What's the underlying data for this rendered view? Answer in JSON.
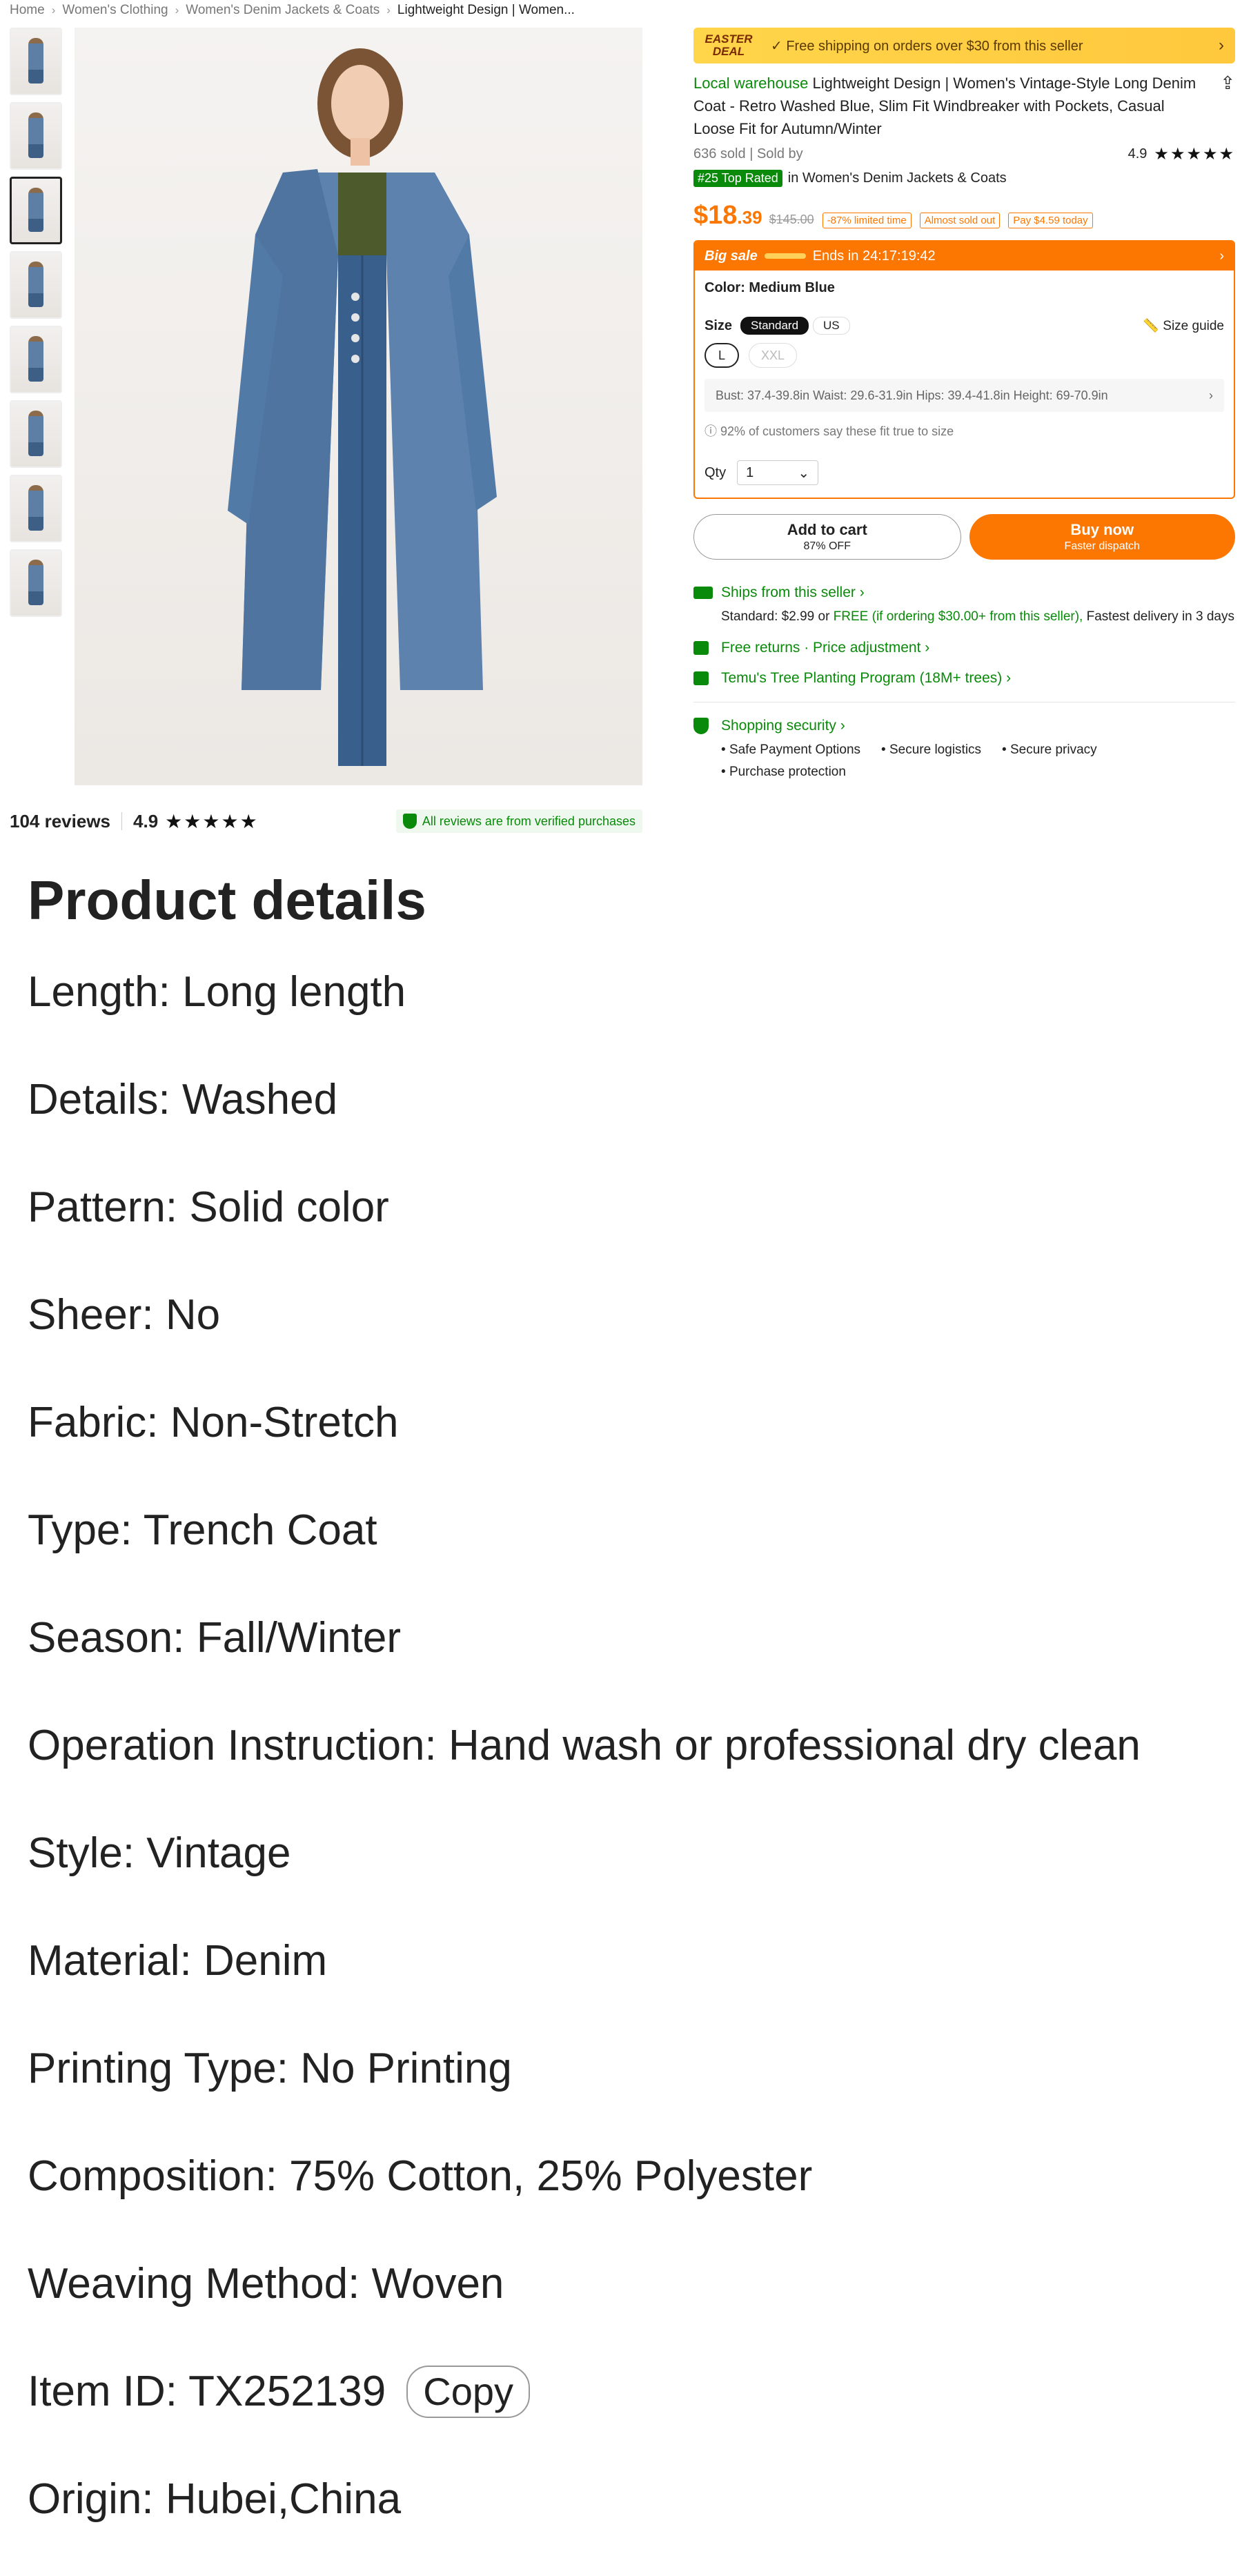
{
  "breadcrumb": [
    "Home",
    "Women's Clothing",
    "Women's Denim Jackets & Coats",
    "Lightweight Design | Women..."
  ],
  "gallery": {
    "thumb_count": 8,
    "active_index": 2
  },
  "reviews": {
    "count": "104 reviews",
    "rating": "4.9",
    "stars": "★★★★★",
    "verified": "All reviews are from verified purchases"
  },
  "promo": {
    "badge_line1": "EASTER",
    "badge_line2": "DEAL",
    "message": "✓ Free shipping on orders over $30 from this seller",
    "chevron": "›"
  },
  "product": {
    "local_label": "Local warehouse",
    "title": "Lightweight Design | Women's Vintage-Style Long Denim Coat - Retro Washed Blue, Slim Fit Windbreaker with Pockets, Casual Loose Fit for Autumn/Winter",
    "sold": "636 sold",
    "sold_by": "| Sold by",
    "rating": "4.9",
    "stars": "★★★★★",
    "top_rated_tag": "#25 Top Rated",
    "top_rated_cat": "in Women's Denim Jackets & Coats",
    "share_icon": "share-icon"
  },
  "pricing": {
    "price_main": "$18",
    "price_cents": ".39",
    "original": "$145.00",
    "chip_limited": "-87% limited time",
    "chip_almost": "Almost sold out",
    "chip_pay": "Pay $4.59 today"
  },
  "sale": {
    "label": "Big sale",
    "ends": "Ends in 24:17:19:42",
    "color_label": "Color: Medium Blue",
    "size_label": "Size",
    "size_system_standard": "Standard",
    "size_system_us": "US",
    "size_guide": "Size guide",
    "sizes": [
      "L",
      "XXL"
    ],
    "measure": "Bust: 37.4-39.8in Waist: 29.6-31.9in Hips: 39.4-41.8in Height: 69-70.9in",
    "fit_note": "ⓘ 92% of customers say these fit true to size",
    "qty_label": "Qty",
    "qty_value": "1"
  },
  "buttons": {
    "add_main": "Add to cart",
    "add_sub": "87% OFF",
    "buy_main": "Buy now",
    "buy_sub": "Faster dispatch"
  },
  "shipping": {
    "title": "Ships from this seller ›",
    "standard": "Standard: $2.99 or",
    "free": "FREE (if ordering $30.00+ from this seller),",
    "fastest": "Fastest delivery in 3 days",
    "returns": "Free returns · Price adjustment ›",
    "tree": "Temu's Tree Planting Program (18M+ trees) ›",
    "security": "Shopping security ›",
    "security_items": [
      "Safe Payment Options",
      "Secure logistics",
      "Secure privacy",
      "Purchase protection"
    ]
  },
  "details": {
    "heading": "Product details",
    "lines": [
      "Length: Long length",
      "Details: Washed",
      "Pattern: Solid color",
      "Sheer: No",
      "Fabric: Non-Stretch",
      "Type: Trench Coat",
      "Season: Fall/Winter",
      "Operation Instruction: Hand wash or professional dry clean",
      "Style: Vintage",
      "Material: Denim",
      "Printing Type: No Printing",
      "Composition: 75% Cotton, 25% Polyester",
      "Weaving Method: Woven"
    ],
    "item_id": "Item ID: TX252139",
    "copy_label": "Copy",
    "origin": "Origin: Hubei,China"
  },
  "colors": {
    "accent": "#fb7701",
    "green": "#0a8a0a"
  }
}
